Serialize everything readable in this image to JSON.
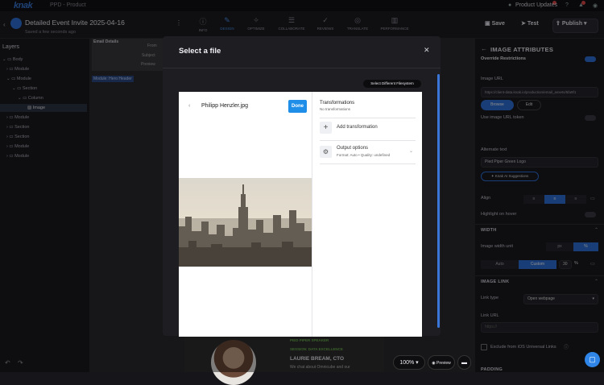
{
  "topbar": {
    "logo": "knak",
    "tenant": "PPD - Product",
    "updates": "Product Updates"
  },
  "header": {
    "title": "Detailed Event Invite 2025-04-16",
    "saved": "Saved a few seconds ago",
    "tabs": [
      "INFO",
      "DESIGN",
      "OPTIMIZE",
      "COLLABORATE",
      "REVIEWS",
      "TRANSLATE",
      "PERFORMANCE"
    ],
    "save": "Save",
    "test": "Test",
    "publish": "Publish"
  },
  "layers": {
    "title": "Layers",
    "items": [
      "Body",
      "Module",
      "Module",
      "Section",
      "Column",
      "Image",
      "Module",
      "Module",
      "Section",
      "Section",
      "Module",
      "Module"
    ]
  },
  "canvas": {
    "email_details": "Email Details",
    "from": "From",
    "subject": "Subject",
    "preview": "Preview",
    "module_label": "Module: Hero Header",
    "speaker_tag": "PIED PIPER SPEAKER",
    "session": "SESSION: DATA EXCELLENCE",
    "speaker_name": "LAURIE BREAM, CTO",
    "speaker_text": "We chat about Omnicube and our",
    "zoom": "100%",
    "preview_btn": "Preview"
  },
  "modal": {
    "title": "Select a file",
    "fs_button": "Select Different Filesystem",
    "filename": "Philipp Henzler.jpg",
    "done": "Done",
    "transformations": "Transformations",
    "no_transformations": "No transformations",
    "add_transformation": "Add transformation",
    "output_options": "Output options",
    "output_format": "Format: Auto • Quality: undefined"
  },
  "right": {
    "title": "IMAGE ATTRIBUTES",
    "override": "Override Restrictions",
    "image_url_label": "Image URL",
    "image_url": "https://client-data.knak.io/production/email_assets/5fa9f1",
    "browse": "Browse",
    "edit": "Edit",
    "use_token": "Use image URL token",
    "alt_label": "Alternate text",
    "alt_value": "Pied Piper Green Logo",
    "ai_btn": "Knak AI Suggestions",
    "align": "Align",
    "highlight": "Highlight on hover",
    "width_section": "WIDTH",
    "width_unit": "Image width unit",
    "px": "px",
    "pct": "%",
    "auto": "Auto",
    "custom": "Custom",
    "width_value": "30",
    "image_link": "IMAGE LINK",
    "link_type_label": "Link type",
    "link_type": "Open webpage",
    "link_url_label": "Link URL",
    "link_url_ph": "https://",
    "ios_links": "Exclude from iOS Universal Links",
    "padding": "PADDING"
  }
}
